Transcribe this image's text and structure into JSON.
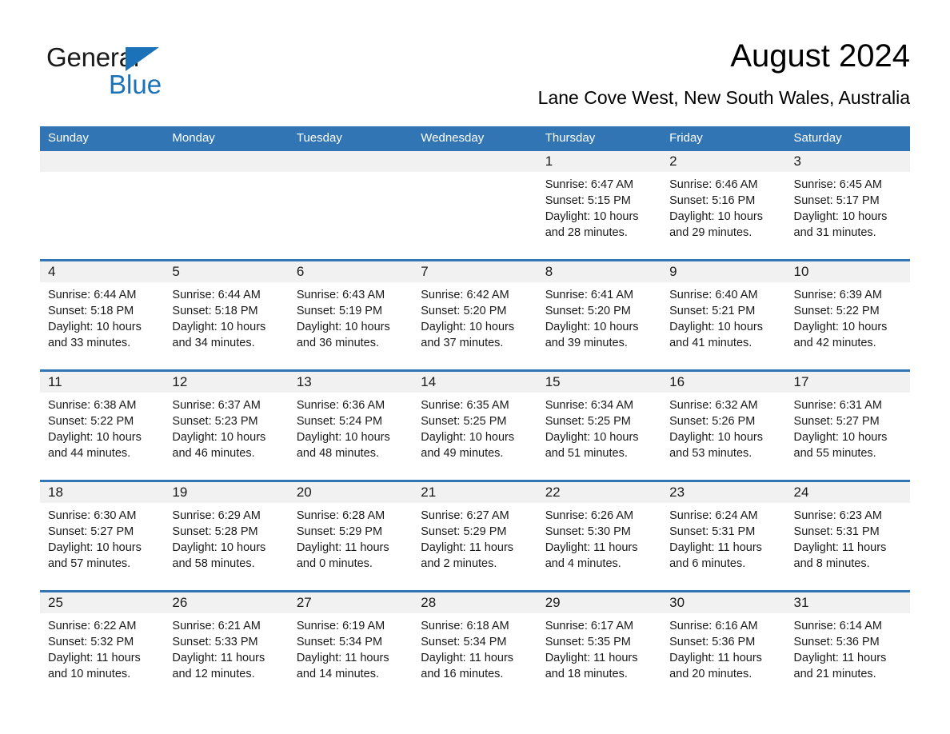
{
  "brand": {
    "name_part1": "General",
    "name_part2": "Blue",
    "accent_color": "#1b72b8"
  },
  "header": {
    "title": "August 2024",
    "subtitle": "Lane Cove West, New South Wales, Australia"
  },
  "theme": {
    "header_blue": "#3175b4",
    "day_band_gray": "#f1f1f1",
    "text": "#1a1a1a"
  },
  "weekday_headers": [
    "Sunday",
    "Monday",
    "Tuesday",
    "Wednesday",
    "Thursday",
    "Friday",
    "Saturday"
  ],
  "weeks": [
    [
      {
        "day": "",
        "sunrise": "",
        "sunset": "",
        "daylight_line1": "",
        "daylight_line2": "",
        "empty": true
      },
      {
        "day": "",
        "sunrise": "",
        "sunset": "",
        "daylight_line1": "",
        "daylight_line2": "",
        "empty": true
      },
      {
        "day": "",
        "sunrise": "",
        "sunset": "",
        "daylight_line1": "",
        "daylight_line2": "",
        "empty": true
      },
      {
        "day": "",
        "sunrise": "",
        "sunset": "",
        "daylight_line1": "",
        "daylight_line2": "",
        "empty": true
      },
      {
        "day": "1",
        "sunrise": "Sunrise: 6:47 AM",
        "sunset": "Sunset: 5:15 PM",
        "daylight_line1": "Daylight: 10 hours",
        "daylight_line2": "and 28 minutes."
      },
      {
        "day": "2",
        "sunrise": "Sunrise: 6:46 AM",
        "sunset": "Sunset: 5:16 PM",
        "daylight_line1": "Daylight: 10 hours",
        "daylight_line2": "and 29 minutes."
      },
      {
        "day": "3",
        "sunrise": "Sunrise: 6:45 AM",
        "sunset": "Sunset: 5:17 PM",
        "daylight_line1": "Daylight: 10 hours",
        "daylight_line2": "and 31 minutes."
      }
    ],
    [
      {
        "day": "4",
        "sunrise": "Sunrise: 6:44 AM",
        "sunset": "Sunset: 5:18 PM",
        "daylight_line1": "Daylight: 10 hours",
        "daylight_line2": "and 33 minutes."
      },
      {
        "day": "5",
        "sunrise": "Sunrise: 6:44 AM",
        "sunset": "Sunset: 5:18 PM",
        "daylight_line1": "Daylight: 10 hours",
        "daylight_line2": "and 34 minutes."
      },
      {
        "day": "6",
        "sunrise": "Sunrise: 6:43 AM",
        "sunset": "Sunset: 5:19 PM",
        "daylight_line1": "Daylight: 10 hours",
        "daylight_line2": "and 36 minutes."
      },
      {
        "day": "7",
        "sunrise": "Sunrise: 6:42 AM",
        "sunset": "Sunset: 5:20 PM",
        "daylight_line1": "Daylight: 10 hours",
        "daylight_line2": "and 37 minutes."
      },
      {
        "day": "8",
        "sunrise": "Sunrise: 6:41 AM",
        "sunset": "Sunset: 5:20 PM",
        "daylight_line1": "Daylight: 10 hours",
        "daylight_line2": "and 39 minutes."
      },
      {
        "day": "9",
        "sunrise": "Sunrise: 6:40 AM",
        "sunset": "Sunset: 5:21 PM",
        "daylight_line1": "Daylight: 10 hours",
        "daylight_line2": "and 41 minutes."
      },
      {
        "day": "10",
        "sunrise": "Sunrise: 6:39 AM",
        "sunset": "Sunset: 5:22 PM",
        "daylight_line1": "Daylight: 10 hours",
        "daylight_line2": "and 42 minutes."
      }
    ],
    [
      {
        "day": "11",
        "sunrise": "Sunrise: 6:38 AM",
        "sunset": "Sunset: 5:22 PM",
        "daylight_line1": "Daylight: 10 hours",
        "daylight_line2": "and 44 minutes."
      },
      {
        "day": "12",
        "sunrise": "Sunrise: 6:37 AM",
        "sunset": "Sunset: 5:23 PM",
        "daylight_line1": "Daylight: 10 hours",
        "daylight_line2": "and 46 minutes."
      },
      {
        "day": "13",
        "sunrise": "Sunrise: 6:36 AM",
        "sunset": "Sunset: 5:24 PM",
        "daylight_line1": "Daylight: 10 hours",
        "daylight_line2": "and 48 minutes."
      },
      {
        "day": "14",
        "sunrise": "Sunrise: 6:35 AM",
        "sunset": "Sunset: 5:25 PM",
        "daylight_line1": "Daylight: 10 hours",
        "daylight_line2": "and 49 minutes."
      },
      {
        "day": "15",
        "sunrise": "Sunrise: 6:34 AM",
        "sunset": "Sunset: 5:25 PM",
        "daylight_line1": "Daylight: 10 hours",
        "daylight_line2": "and 51 minutes."
      },
      {
        "day": "16",
        "sunrise": "Sunrise: 6:32 AM",
        "sunset": "Sunset: 5:26 PM",
        "daylight_line1": "Daylight: 10 hours",
        "daylight_line2": "and 53 minutes."
      },
      {
        "day": "17",
        "sunrise": "Sunrise: 6:31 AM",
        "sunset": "Sunset: 5:27 PM",
        "daylight_line1": "Daylight: 10 hours",
        "daylight_line2": "and 55 minutes."
      }
    ],
    [
      {
        "day": "18",
        "sunrise": "Sunrise: 6:30 AM",
        "sunset": "Sunset: 5:27 PM",
        "daylight_line1": "Daylight: 10 hours",
        "daylight_line2": "and 57 minutes."
      },
      {
        "day": "19",
        "sunrise": "Sunrise: 6:29 AM",
        "sunset": "Sunset: 5:28 PM",
        "daylight_line1": "Daylight: 10 hours",
        "daylight_line2": "and 58 minutes."
      },
      {
        "day": "20",
        "sunrise": "Sunrise: 6:28 AM",
        "sunset": "Sunset: 5:29 PM",
        "daylight_line1": "Daylight: 11 hours",
        "daylight_line2": "and 0 minutes."
      },
      {
        "day": "21",
        "sunrise": "Sunrise: 6:27 AM",
        "sunset": "Sunset: 5:29 PM",
        "daylight_line1": "Daylight: 11 hours",
        "daylight_line2": "and 2 minutes."
      },
      {
        "day": "22",
        "sunrise": "Sunrise: 6:26 AM",
        "sunset": "Sunset: 5:30 PM",
        "daylight_line1": "Daylight: 11 hours",
        "daylight_line2": "and 4 minutes."
      },
      {
        "day": "23",
        "sunrise": "Sunrise: 6:24 AM",
        "sunset": "Sunset: 5:31 PM",
        "daylight_line1": "Daylight: 11 hours",
        "daylight_line2": "and 6 minutes."
      },
      {
        "day": "24",
        "sunrise": "Sunrise: 6:23 AM",
        "sunset": "Sunset: 5:31 PM",
        "daylight_line1": "Daylight: 11 hours",
        "daylight_line2": "and 8 minutes."
      }
    ],
    [
      {
        "day": "25",
        "sunrise": "Sunrise: 6:22 AM",
        "sunset": "Sunset: 5:32 PM",
        "daylight_line1": "Daylight: 11 hours",
        "daylight_line2": "and 10 minutes."
      },
      {
        "day": "26",
        "sunrise": "Sunrise: 6:21 AM",
        "sunset": "Sunset: 5:33 PM",
        "daylight_line1": "Daylight: 11 hours",
        "daylight_line2": "and 12 minutes."
      },
      {
        "day": "27",
        "sunrise": "Sunrise: 6:19 AM",
        "sunset": "Sunset: 5:34 PM",
        "daylight_line1": "Daylight: 11 hours",
        "daylight_line2": "and 14 minutes."
      },
      {
        "day": "28",
        "sunrise": "Sunrise: 6:18 AM",
        "sunset": "Sunset: 5:34 PM",
        "daylight_line1": "Daylight: 11 hours",
        "daylight_line2": "and 16 minutes."
      },
      {
        "day": "29",
        "sunrise": "Sunrise: 6:17 AM",
        "sunset": "Sunset: 5:35 PM",
        "daylight_line1": "Daylight: 11 hours",
        "daylight_line2": "and 18 minutes."
      },
      {
        "day": "30",
        "sunrise": "Sunrise: 6:16 AM",
        "sunset": "Sunset: 5:36 PM",
        "daylight_line1": "Daylight: 11 hours",
        "daylight_line2": "and 20 minutes."
      },
      {
        "day": "31",
        "sunrise": "Sunrise: 6:14 AM",
        "sunset": "Sunset: 5:36 PM",
        "daylight_line1": "Daylight: 11 hours",
        "daylight_line2": "and 21 minutes."
      }
    ]
  ]
}
